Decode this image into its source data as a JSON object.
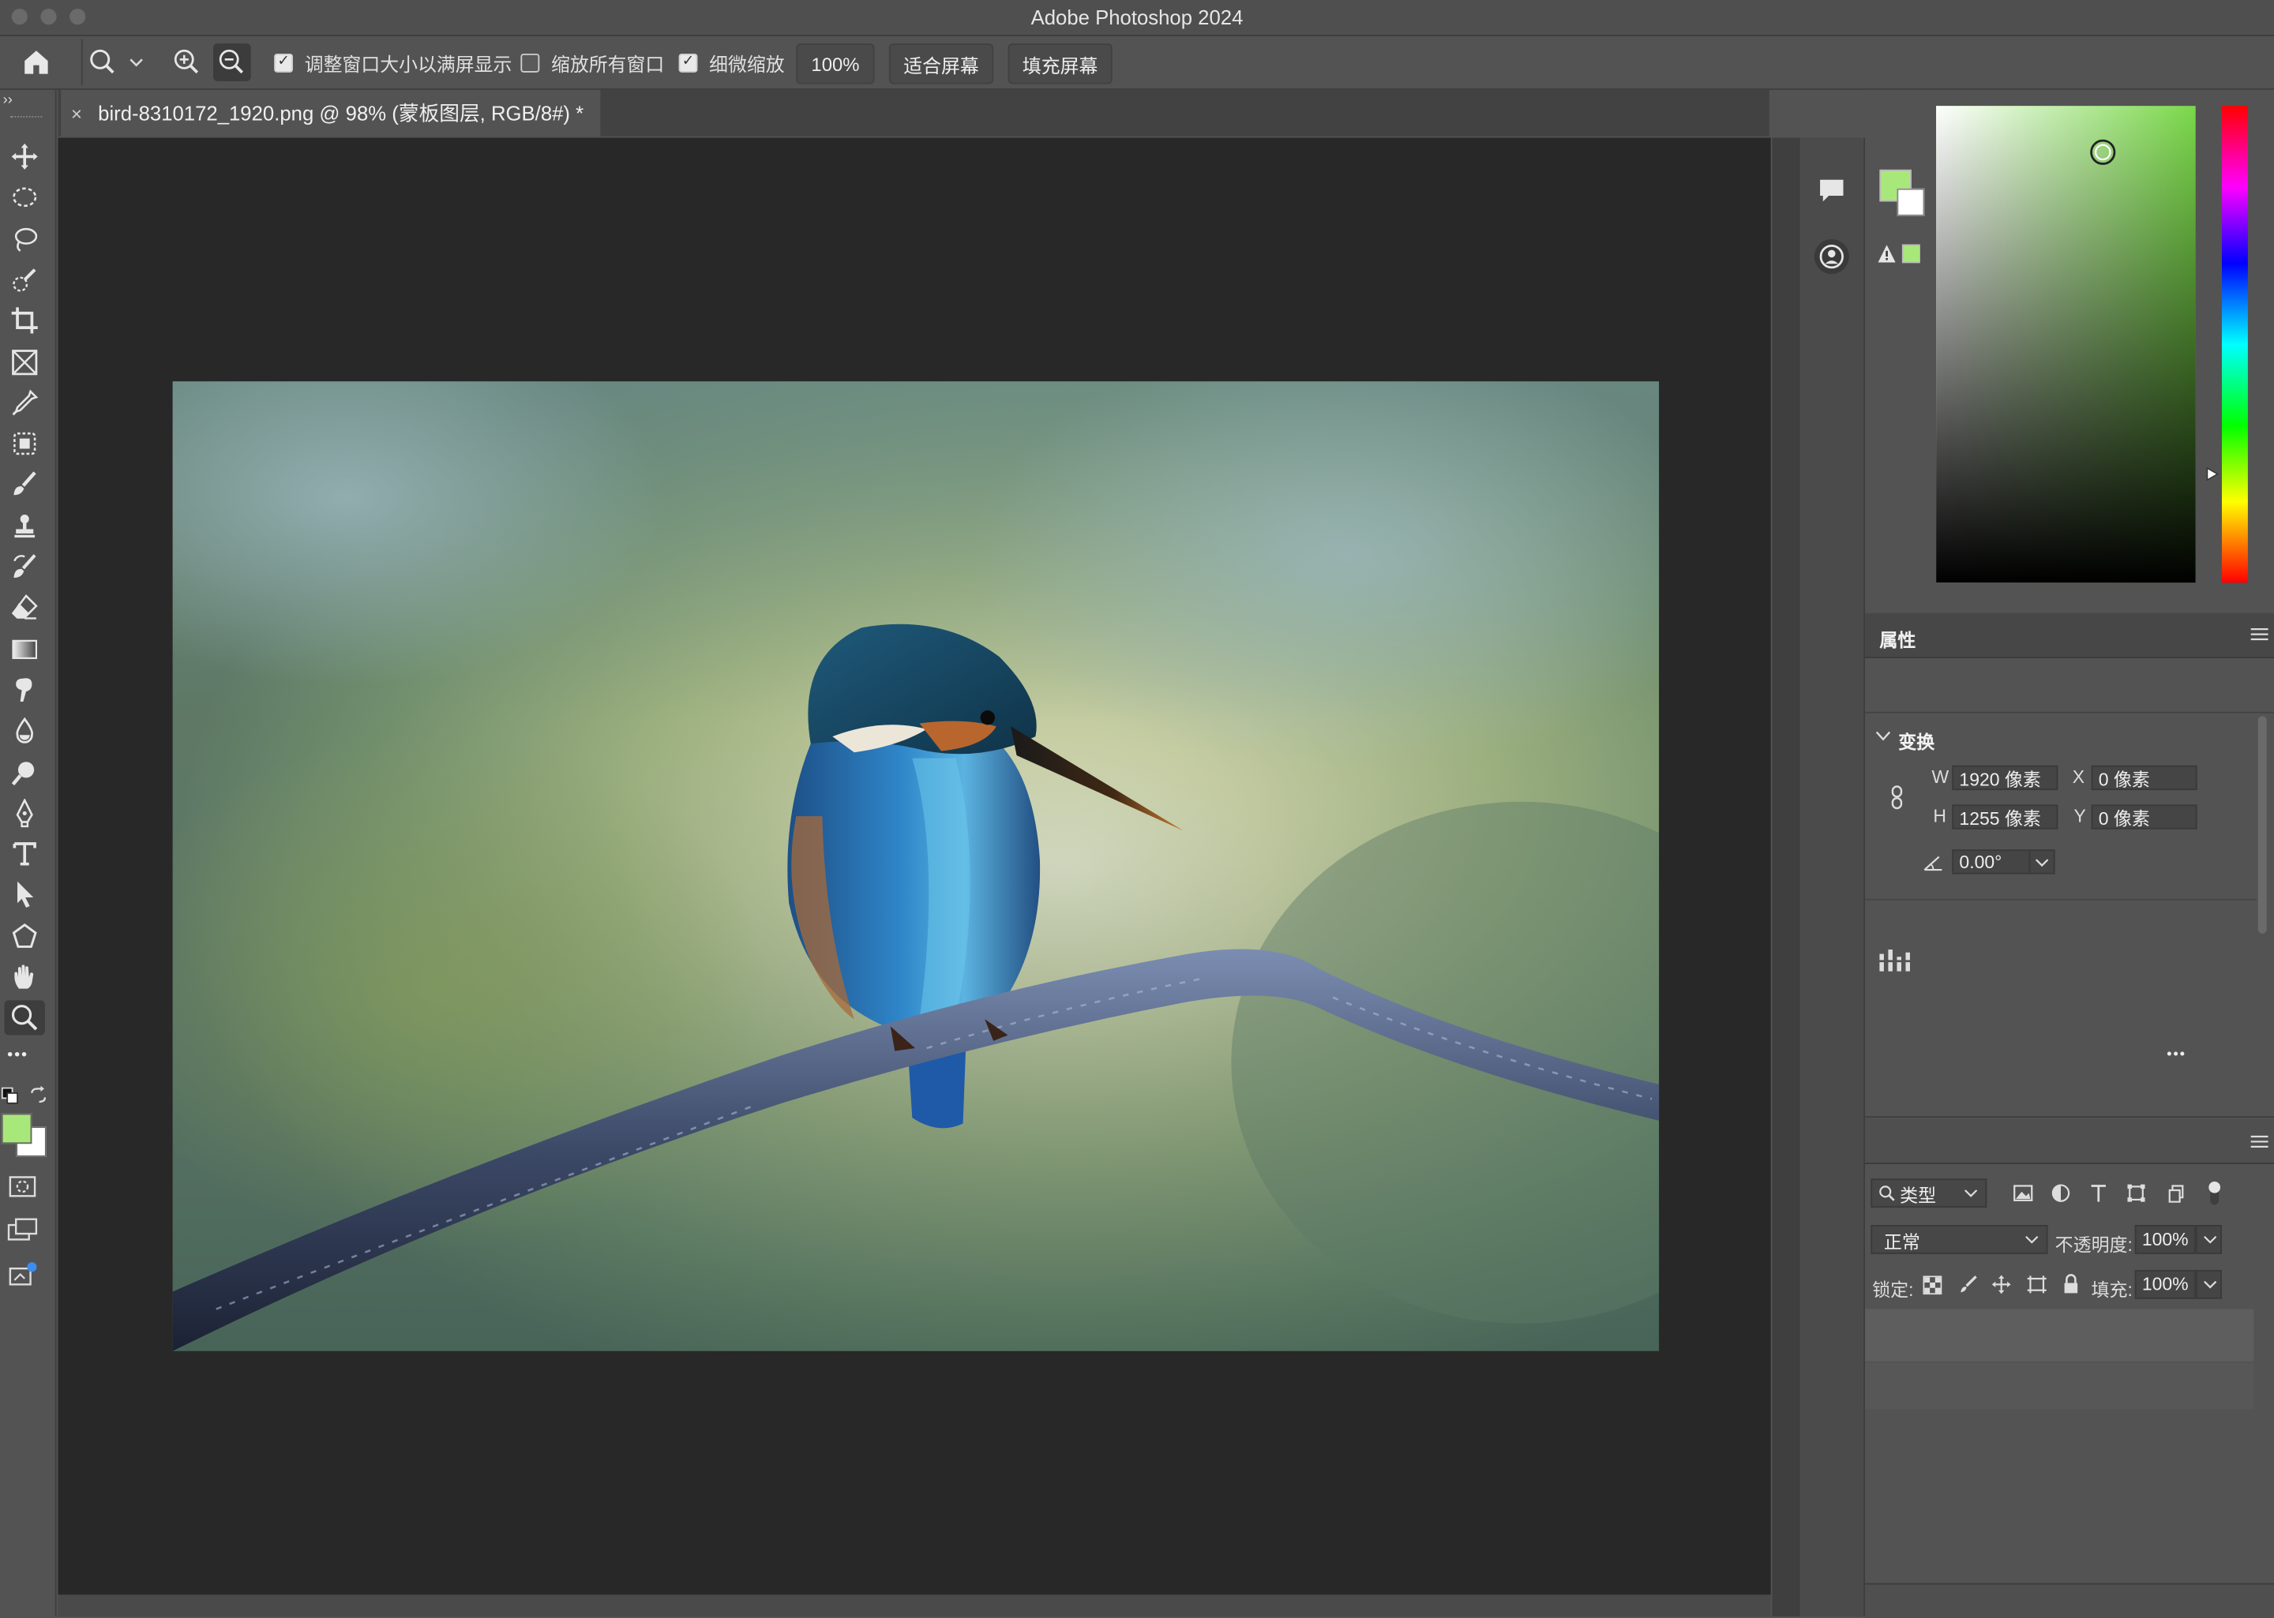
{
  "app": {
    "window_title": "Adobe Photoshop 2024"
  },
  "options_bar": {
    "resize_windows_label": "调整窗口大小以满屏显示",
    "resize_windows_checked": true,
    "zoom_all_label": "缩放所有窗口",
    "zoom_all_checked": false,
    "scrubby_zoom_label": "细微缩放",
    "scrubby_zoom_checked": true,
    "zoom_percent": "100%",
    "fit_screen": "适合屏幕",
    "fill_screen": "填充屏幕",
    "check_mark": "✓"
  },
  "document_tab": {
    "title": "bird-8310172_1920.png @ 98% (蒙板图层, RGB/8#) *",
    "close_glyph": "×"
  },
  "colors": {
    "foreground": "#a8e87a",
    "background": "#ffffff",
    "picker_hue": "#7ad84a",
    "canvas_bg": "#282828",
    "panel_bg": "#535353"
  },
  "tools": [
    {
      "name": "move-tool-icon"
    },
    {
      "name": "elliptical-marquee-icon"
    },
    {
      "name": "lasso-icon"
    },
    {
      "name": "quick-selection-icon"
    },
    {
      "name": "crop-icon"
    },
    {
      "name": "frame-icon"
    },
    {
      "name": "eyedropper-icon"
    },
    {
      "name": "spot-healing-icon"
    },
    {
      "name": "brush-icon"
    },
    {
      "name": "clone-stamp-icon"
    },
    {
      "name": "history-brush-icon"
    },
    {
      "name": "eraser-icon"
    },
    {
      "name": "gradient-icon"
    },
    {
      "name": "smudge-icon"
    },
    {
      "name": "blur-icon"
    },
    {
      "name": "dodge-icon"
    },
    {
      "name": "pen-icon"
    },
    {
      "name": "type-icon"
    },
    {
      "name": "path-selection-icon"
    },
    {
      "name": "shape-icon"
    },
    {
      "name": "hand-icon"
    },
    {
      "name": "zoom-icon"
    }
  ],
  "properties_panel": {
    "title": "属性",
    "transform_section": "变换",
    "w_label": "W",
    "w_value": "1920 像素",
    "h_label": "H",
    "h_value": "1255 像素",
    "x_label": "X",
    "x_value": "0 像素",
    "y_label": "Y",
    "y_value": "0 像素",
    "angle_value": "0.00°",
    "more_glyph": "•••"
  },
  "layers_panel": {
    "filter_label": "类型",
    "blend_mode": "正常",
    "opacity_label": "不透明度:",
    "opacity_value": "100%",
    "lock_label": "锁定:",
    "fill_label": "填充:",
    "fill_value": "100%"
  },
  "toolbar_more": "•••"
}
